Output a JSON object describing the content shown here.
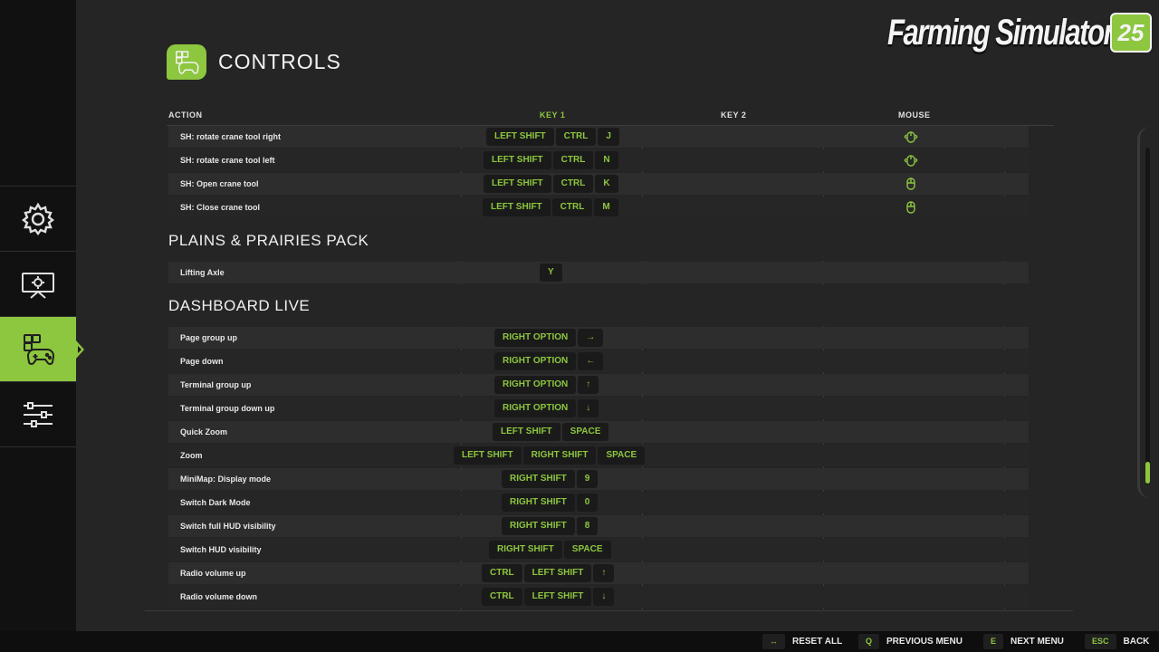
{
  "header": {
    "title": "CONTROLS"
  },
  "logo": {
    "text": "Farming Simulator",
    "badge": "25"
  },
  "sidebar": {
    "items": [
      {
        "icon": "gear-icon"
      },
      {
        "icon": "display-settings-icon"
      },
      {
        "icon": "controls-icon",
        "active": true
      },
      {
        "icon": "sliders-icon"
      }
    ]
  },
  "columns": {
    "action": "ACTION",
    "key1": "KEY 1",
    "key2": "KEY 2",
    "mouse": "MOUSE"
  },
  "groups": [
    {
      "title": "",
      "rows": [
        {
          "label": "SH: rotate crane tool right",
          "keys": [
            "LEFT SHIFT",
            "CTRL",
            "J"
          ],
          "mouse": true
        },
        {
          "label": "SH: rotate crane tool left",
          "keys": [
            "LEFT SHIFT",
            "CTRL",
            "N"
          ],
          "mouse": true
        },
        {
          "label": "SH: Open crane tool",
          "keys": [
            "LEFT SHIFT",
            "CTRL",
            "K"
          ],
          "mouse": true
        },
        {
          "label": "SH: Close crane tool",
          "keys": [
            "LEFT SHIFT",
            "CTRL",
            "M"
          ],
          "mouse": true
        }
      ]
    },
    {
      "title": "PLAINS & PRAIRIES PACK",
      "rows": [
        {
          "label": "Lifting Axle",
          "keys": [
            "Y"
          ],
          "mouse": false
        }
      ]
    },
    {
      "title": "DASHBOARD LIVE",
      "rows": [
        {
          "label": "Page group up",
          "keys": [
            "RIGHT OPTION",
            "→"
          ],
          "mouse": false
        },
        {
          "label": "Page down",
          "keys": [
            "RIGHT OPTION",
            "←"
          ],
          "mouse": false
        },
        {
          "label": "Terminal group up",
          "keys": [
            "RIGHT OPTION",
            "↑"
          ],
          "mouse": false
        },
        {
          "label": "Terminal group down up",
          "keys": [
            "RIGHT OPTION",
            "↓"
          ],
          "mouse": false
        },
        {
          "label": "Quick Zoom",
          "keys": [
            "LEFT SHIFT",
            "SPACE"
          ],
          "mouse": false
        },
        {
          "label": "Zoom",
          "keys": [
            "LEFT SHIFT",
            "RIGHT SHIFT",
            "SPACE"
          ],
          "mouse": false
        },
        {
          "label": "MiniMap: Display mode",
          "keys": [
            "RIGHT SHIFT",
            "9"
          ],
          "mouse": false
        },
        {
          "label": "Switch Dark Mode",
          "keys": [
            "RIGHT SHIFT",
            "0"
          ],
          "mouse": false
        },
        {
          "label": "Switch full HUD visibility",
          "keys": [
            "RIGHT SHIFT",
            "8"
          ],
          "mouse": false
        },
        {
          "label": "Switch HUD visibility",
          "keys": [
            "RIGHT SHIFT",
            "SPACE"
          ],
          "mouse": false
        },
        {
          "label": "Radio volume up",
          "keys": [
            "CTRL",
            "LEFT SHIFT",
            "↑"
          ],
          "mouse": false
        },
        {
          "label": "Radio volume down",
          "keys": [
            "CTRL",
            "LEFT SHIFT",
            "↓"
          ],
          "mouse": false
        }
      ]
    }
  ],
  "footer": [
    {
      "key": "↔",
      "label": "RESET ALL"
    },
    {
      "key": "Q",
      "label": "PREVIOUS MENU"
    },
    {
      "key": "E",
      "label": "NEXT MENU"
    },
    {
      "key": "ESC",
      "label": "BACK"
    }
  ],
  "colors": {
    "accent": "#8dc63f",
    "background": "#252525",
    "sidebar": "#111111"
  }
}
